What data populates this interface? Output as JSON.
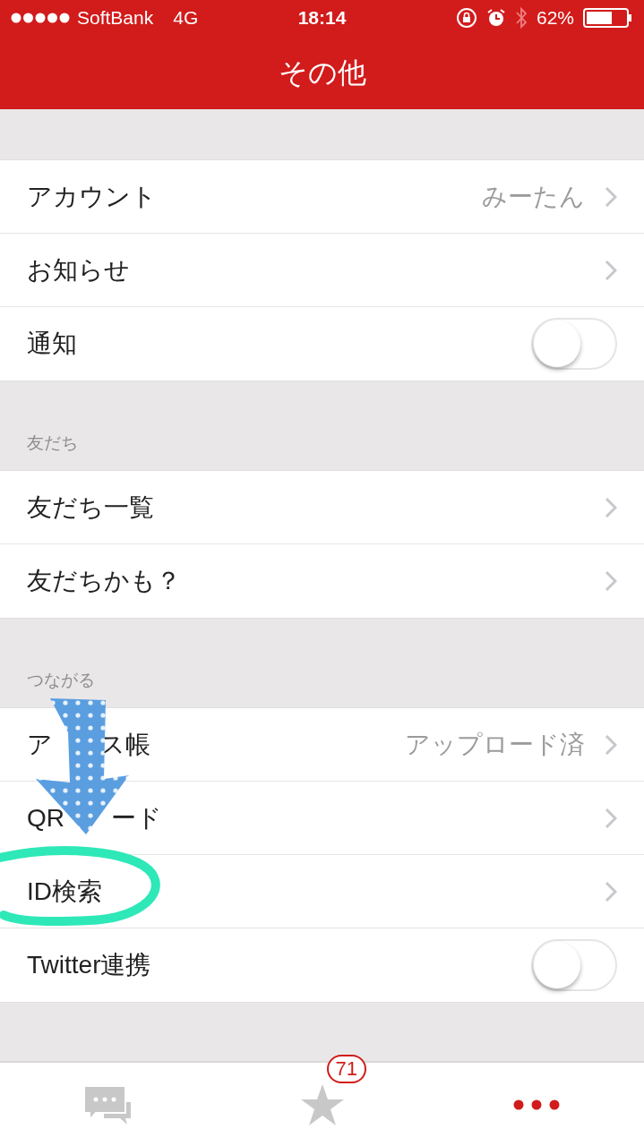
{
  "status_bar": {
    "carrier": "SoftBank",
    "network": "4G",
    "time": "18:14",
    "battery": "62%"
  },
  "title": "その他",
  "sections": [
    {
      "rows": [
        {
          "kind": "link",
          "label_parts": [
            "アカウント"
          ],
          "value": "みーたん"
        },
        {
          "kind": "link",
          "label_parts": [
            "お知らせ"
          ]
        },
        {
          "kind": "toggle",
          "label_parts": [
            "通知"
          ],
          "on": false
        }
      ]
    },
    {
      "header": "友だち",
      "rows": [
        {
          "kind": "link",
          "label_parts": [
            "友だち一覧"
          ]
        },
        {
          "kind": "link",
          "label_parts": [
            "友だちかも？"
          ]
        }
      ]
    },
    {
      "header": "つながる",
      "rows": [
        {
          "kind": "link",
          "label_parts": [
            "ア",
            "ス帳"
          ],
          "value": "アップロード済"
        },
        {
          "kind": "link",
          "label_parts": [
            "QR",
            "ード"
          ]
        },
        {
          "kind": "link",
          "label_parts": [
            "ID検索"
          ]
        },
        {
          "kind": "toggle",
          "label_parts": [
            "Twitter連携"
          ],
          "on": false
        }
      ]
    }
  ],
  "tab_bar": [
    {
      "kind": "chat",
      "selected": false
    },
    {
      "kind": "star",
      "selected": false,
      "badge": "71"
    },
    {
      "kind": "more",
      "selected": true
    }
  ]
}
